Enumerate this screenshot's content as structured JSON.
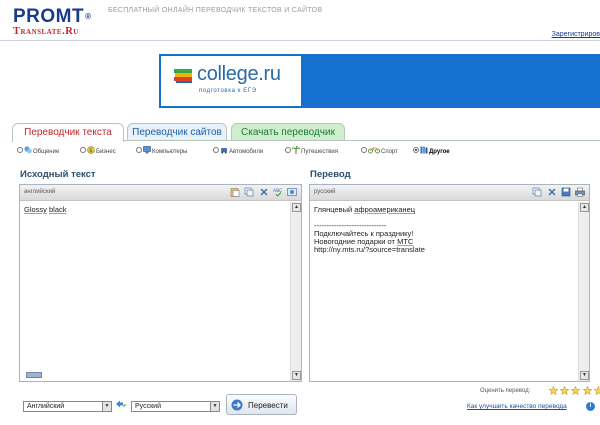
{
  "header": {
    "logo_top": "PROMT",
    "logo_reg": "®",
    "logo_bottom": "Translate.Ru",
    "tagline": "БЕСПЛАТНЫЙ ОНЛАЙН ПЕРЕВОДЧИК ТЕКСТОВ И САЙТОВ",
    "register_link": "Зарегистриров"
  },
  "banner": {
    "title": "college.ru",
    "subtitle": "подготовка к ЕГЭ",
    "bg_color": "#1570cf"
  },
  "tabs": [
    {
      "label": "Переводчик текста",
      "active": true
    },
    {
      "label": "Переводчик сайтов",
      "active": false
    },
    {
      "label": "Скачать переводчик",
      "active": false
    }
  ],
  "topics": [
    {
      "label": "Общение",
      "icon": "chat-icon",
      "selected": false
    },
    {
      "label": "Бизнес",
      "icon": "business-icon",
      "selected": false
    },
    {
      "label": "Компьютеры",
      "icon": "computer-icon",
      "selected": false
    },
    {
      "label": "Автомобили",
      "icon": "car-icon",
      "selected": false
    },
    {
      "label": "Путешествия",
      "icon": "palm-icon",
      "selected": false
    },
    {
      "label": "Спорт",
      "icon": "bicycle-icon",
      "selected": false
    },
    {
      "label": "Другое",
      "icon": "books-icon",
      "selected": true
    }
  ],
  "source": {
    "title": "Исходный текст",
    "language_label": "английский",
    "words": [
      "Glossy",
      "black"
    ]
  },
  "target": {
    "title": "Перевод",
    "language_label": "русский",
    "translation_word1": "Глянцевый",
    "translation_word2": "афроамериканец",
    "ad_separator": "-----------------------------",
    "ad_line1": "Подключайтесь к празднику!",
    "ad_line2_prefix": "Новогодние подарки от",
    "ad_line2_link": "МТС",
    "ad_url": "http://ny.mts.ru/?source=translate"
  },
  "controls": {
    "source_lang": "Английский",
    "target_lang": "Русский",
    "translate_button": "Перевести",
    "rate_label": "Оценить перевод:",
    "improve_link": "Как улучшить качество перевода"
  }
}
